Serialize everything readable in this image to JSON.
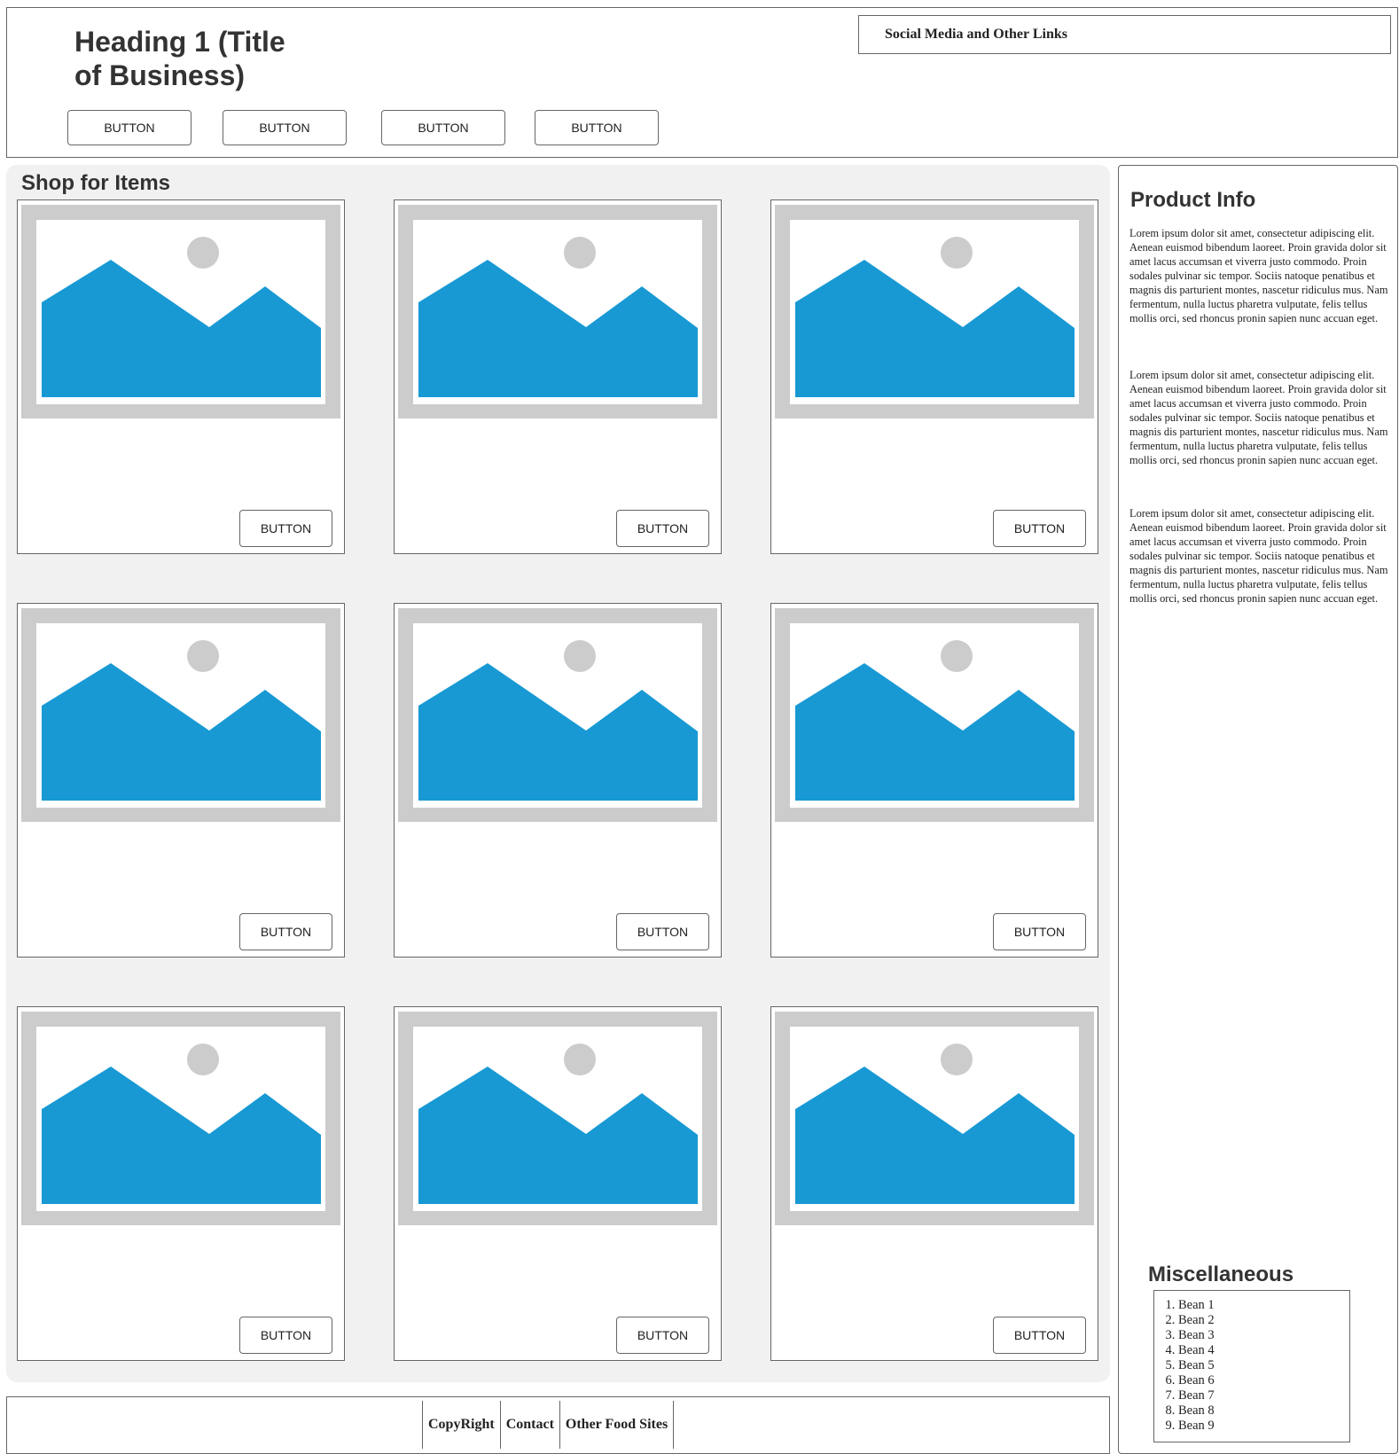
{
  "header": {
    "title": "Heading 1 (Title\nof Business)",
    "social_label": "Social Media and Other Links",
    "nav_buttons": [
      "BUTTON",
      "BUTTON",
      "BUTTON",
      "BUTTON"
    ]
  },
  "shop": {
    "title": "Shop for Items",
    "cards": [
      {
        "button": "BUTTON"
      },
      {
        "button": "BUTTON"
      },
      {
        "button": "BUTTON"
      },
      {
        "button": "BUTTON"
      },
      {
        "button": "BUTTON"
      },
      {
        "button": "BUTTON"
      },
      {
        "button": "BUTTON"
      },
      {
        "button": "BUTTON"
      },
      {
        "button": "BUTTON"
      }
    ]
  },
  "sidebar": {
    "title": "Product Info",
    "paragraphs": [
      "Lorem ipsum dolor sit amet, consectetur adipiscing elit. Aenean euismod bibendum laoreet. Proin gravida dolor sit amet lacus accumsan et viverra justo commodo. Proin sodales pulvinar sic tempor. Sociis natoque penatibus et magnis dis parturient montes, nascetur ridiculus mus. Nam fermentum, nulla luctus pharetra vulputate, felis tellus mollis orci, sed rhoncus pronin sapien nunc accuan eget.",
      "Lorem ipsum dolor sit amet, consectetur adipiscing elit. Aenean euismod bibendum laoreet. Proin gravida dolor sit amet lacus accumsan et viverra justo commodo. Proin sodales pulvinar sic tempor. Sociis natoque penatibus et magnis dis parturient montes, nascetur ridiculus mus. Nam fermentum, nulla luctus pharetra vulputate, felis tellus mollis orci, sed rhoncus pronin sapien nunc accuan eget.",
      "Lorem ipsum dolor sit amet, consectetur adipiscing elit. Aenean euismod bibendum laoreet. Proin gravida dolor sit amet lacus accumsan et viverra justo commodo. Proin sodales pulvinar sic tempor. Sociis natoque penatibus et magnis dis parturient montes, nascetur ridiculus mus. Nam fermentum, nulla luctus pharetra vulputate, felis tellus mollis orci, sed rhoncus pronin sapien nunc accuan eget."
    ],
    "misc_title": "Miscellaneous",
    "misc_items": [
      "Bean 1",
      "Bean 2",
      "Bean 3",
      "Bean 4",
      "Bean 5",
      "Bean 6",
      "Bean 7",
      "Bean 8",
      "Bean 9"
    ]
  },
  "footer": {
    "links": [
      "CopyRight",
      "Contact",
      "Other Food Sites"
    ]
  },
  "colors": {
    "image_placeholder_blue": "#1899d4",
    "image_placeholder_frame": "#cccccc",
    "shop_background": "#f1f1f1"
  }
}
